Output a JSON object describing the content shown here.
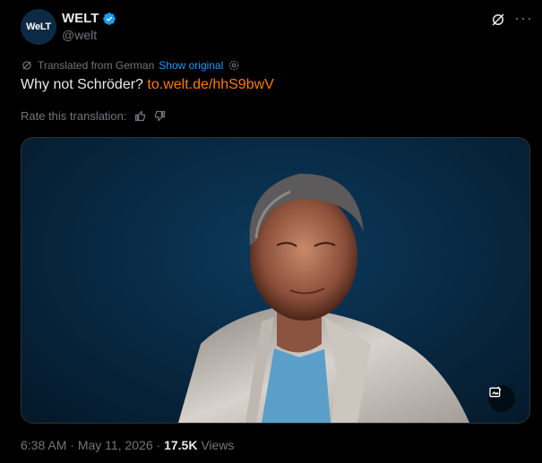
{
  "author": {
    "name": "WELT",
    "handle": "@welt",
    "avatar_text": "WeLT",
    "verified": true
  },
  "translation": {
    "label": "Translated from German",
    "show_original": "Show original"
  },
  "tweet": {
    "text": "Why not Schröder?",
    "link": "to.welt.de/hhS9bwV"
  },
  "rate": {
    "label": "Rate this translation:"
  },
  "meta": {
    "time": "6:38 AM",
    "date": "May 11, 2026",
    "separator": " · ",
    "views_count": "17.5K",
    "views_label": "Views"
  },
  "colors": {
    "background": "#000000",
    "link_orange": "#ff7a00",
    "link_blue": "#1d9bf0",
    "muted": "#71767b",
    "verified": "#1d9bf0"
  },
  "icons": [
    "grok-icon",
    "more-icon",
    "translate-icon",
    "settings-icon",
    "thumbs-up-icon",
    "thumbs-down-icon",
    "alt-edit-icon",
    "verified-badge-icon"
  ]
}
